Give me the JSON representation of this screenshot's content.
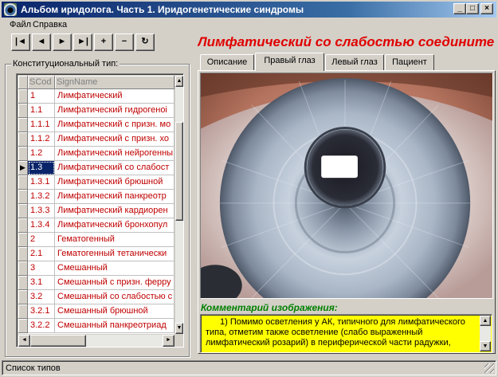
{
  "window": {
    "title": "Альбом иридолога. Часть 1. Иридогенетические синдромы",
    "min_glyph": "_",
    "max_glyph": "□",
    "close_glyph": "×"
  },
  "menu": {
    "file": "Файл",
    "help": "Справка"
  },
  "toolbar": {
    "first": "|◄",
    "prev": "◄",
    "next": "►",
    "last": "►|",
    "insert": "+",
    "delete": "−",
    "refresh": "↻"
  },
  "group": {
    "label": "Конституциональный тип:"
  },
  "grid": {
    "columns": [
      "SCod",
      "SignName"
    ],
    "selected_indicator": "▶",
    "rows": [
      {
        "code": "1",
        "name": "Лимфатический"
      },
      {
        "code": "1.1",
        "name": "Лимфатический гидрогеноі"
      },
      {
        "code": "1.1.1",
        "name": "Лимфатический с призн. мо"
      },
      {
        "code": "1.1.2",
        "name": "Лимфатический с призн. хо"
      },
      {
        "code": "1.2",
        "name": "Лимфатический нейрогенны"
      },
      {
        "code": "1.3",
        "name": "Лимфатический со слабост",
        "selected": true
      },
      {
        "code": "1.3.1",
        "name": "Лимфатический брюшной"
      },
      {
        "code": "1.3.2",
        "name": "Лимфатический панкреотр"
      },
      {
        "code": "1.3.3",
        "name": "Лимфатический кардиорен"
      },
      {
        "code": "1.3.4",
        "name": "Лимфатический бронхопул"
      },
      {
        "code": "2",
        "name": "Гематогенный"
      },
      {
        "code": "2.1",
        "name": "Гематогенный тетанически"
      },
      {
        "code": "3",
        "name": "Смешанный"
      },
      {
        "code": "3.1",
        "name": "Смешанный с призн. ферру"
      },
      {
        "code": "3.2",
        "name": "Смешанный со слабостью с"
      },
      {
        "code": "3.2.1",
        "name": "Смешанный брюшной"
      },
      {
        "code": "3.2.2",
        "name": "Смешанный панкреотриад"
      }
    ]
  },
  "record": {
    "title": "Лимфатический со слабостью соедините"
  },
  "tabs": [
    {
      "label": "Описание",
      "active": false
    },
    {
      "label": "Правый глаз",
      "active": true
    },
    {
      "label": "Левый глаз",
      "active": false
    },
    {
      "label": "Пациент",
      "active": false
    }
  ],
  "comment": {
    "label": "Комментарий изображения:",
    "text": "1) Помимо осветления у АК, типичного для лимфатического типа, отметим также осветление (слабо выраженный лимфатический розарий) в периферической части радужки,"
  },
  "status": {
    "text": "Список типов"
  },
  "colors": {
    "title_bar": "#0a246a",
    "record_title": "#e00000",
    "comment_label": "#008000",
    "comment_bg": "#ffff00",
    "grid_text": "#c00000"
  }
}
